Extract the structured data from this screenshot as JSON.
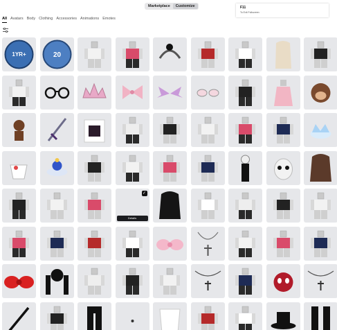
{
  "segment": {
    "marketplace": "Marketplace",
    "customize": "Customize"
  },
  "toast": {
    "key": "F11",
    "hint": "To Exit Fullscreen"
  },
  "tabs": [
    "All",
    "Avatars",
    "Body",
    "Clothing",
    "Accessories",
    "Animations",
    "Emotes"
  ],
  "filter_icon": "sliders-icon",
  "badges": {
    "one_year": "1YR+",
    "twenty": "20"
  },
  "details_label": "Details",
  "items": [
    "one-year-badge",
    "twenty-badge",
    "avatar",
    "avatar",
    "hair-bow-headband",
    "avatar",
    "avatar",
    "blonde-hair",
    "avatar",
    "avatar",
    "sunglasses",
    "tiara",
    "bow",
    "bat-wings",
    "goggles",
    "avatar",
    "pink-dress",
    "monkey",
    "monkey-small",
    "sword",
    "gothic-shirt",
    "avatar",
    "avatar",
    "avatar",
    "avatar",
    "avatar",
    "cloud-crown",
    "cup",
    "cloud-hat",
    "avatar",
    "avatar",
    "avatar",
    "avatar",
    "doll-avatar",
    "mask",
    "brown-hair",
    "avatar",
    "avatar",
    "avatar",
    "selected-empty",
    "black-hair",
    "avatar",
    "avatar",
    "avatar",
    "avatar",
    "avatar",
    "avatar",
    "avatar",
    "avatar",
    "pink-bow",
    "cross-necklace",
    "avatar",
    "avatar",
    "avatar",
    "red-bow",
    "black-pigtails",
    "avatar",
    "avatar",
    "avatar",
    "cross-chain",
    "avatar",
    "spider-plush",
    "cross-chain",
    "black-sword",
    "avatar",
    "black-pants",
    "bead",
    "white-top",
    "avatar",
    "avatar",
    "black-hat",
    "black-boots"
  ],
  "colors": {
    "tile_bg": "#e6e7ea",
    "active_tab": "#000000",
    "details_bg": "#1b1c1f"
  }
}
